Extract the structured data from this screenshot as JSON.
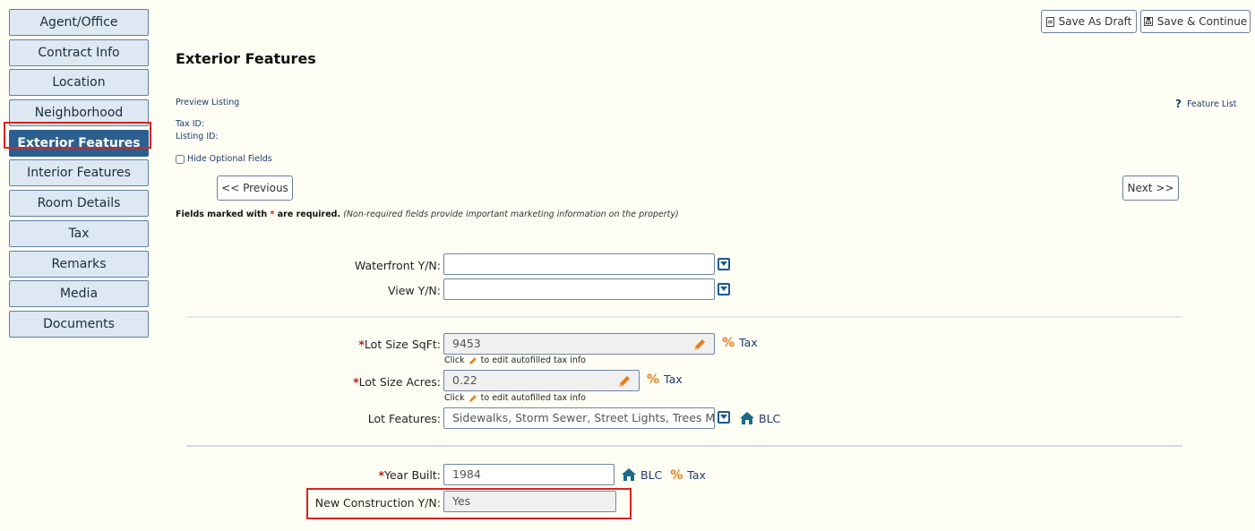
{
  "sidebar": {
    "items": [
      {
        "label": "Agent/Office"
      },
      {
        "label": "Contract Info"
      },
      {
        "label": "Location"
      },
      {
        "label": "Neighborhood"
      },
      {
        "label": "Exterior Features",
        "active": true
      },
      {
        "label": "Interior Features"
      },
      {
        "label": "Room Details"
      },
      {
        "label": "Tax"
      },
      {
        "label": "Remarks"
      },
      {
        "label": "Media"
      },
      {
        "label": "Documents"
      }
    ]
  },
  "toolbar": {
    "save_draft_label": "Save As Draft",
    "save_continue_label": "Save & Continue"
  },
  "page": {
    "title": "Exterior Features",
    "preview_link": "Preview Listing",
    "feature_list_link": "Feature List",
    "tax_id_label": "Tax ID:",
    "listing_id_label": "Listing ID:",
    "hide_optional_label": "Hide Optional Fields",
    "previous_label": "<< Previous",
    "next_label": "Next >>",
    "required_note_prefix": "Fields marked with ",
    "required_star": "*",
    "required_note_suffix": " are required.",
    "required_note_italic": "(Non-required fields provide important marketing information on the property)"
  },
  "form": {
    "waterfront": {
      "label": "Waterfront Y/N:",
      "value": ""
    },
    "view": {
      "label": "View Y/N:",
      "value": ""
    },
    "lot_size_sqft": {
      "label": "Lot Size SqFt:",
      "value": "9453",
      "source": "Tax"
    },
    "lot_size_acres": {
      "label": "Lot Size Acres:",
      "value": "0.22",
      "source": "Tax"
    },
    "hint_prefix": "Click",
    "hint_suffix": "to edit autofilled tax info",
    "lot_features": {
      "label": "Lot Features:",
      "value": "Sidewalks, Storm Sewer, Street Lights, Trees Mature",
      "source": "BLC"
    },
    "year_built": {
      "label": "Year Built:",
      "value": "1984",
      "source1": "BLC",
      "source2": "Tax"
    },
    "new_construction": {
      "label": "New Construction Y/N:",
      "value": "Yes"
    }
  },
  "colors": {
    "accent": "#2b5f8f",
    "highlight": "#d9231b",
    "tax_icon": "#e57d1e",
    "link": "#1f3a6b"
  },
  "icons": {
    "dropdown": "caret-down-square-icon",
    "pencil": "pencil-icon",
    "percent": "percent-icon",
    "home": "home-icon",
    "help": "question-icon"
  }
}
